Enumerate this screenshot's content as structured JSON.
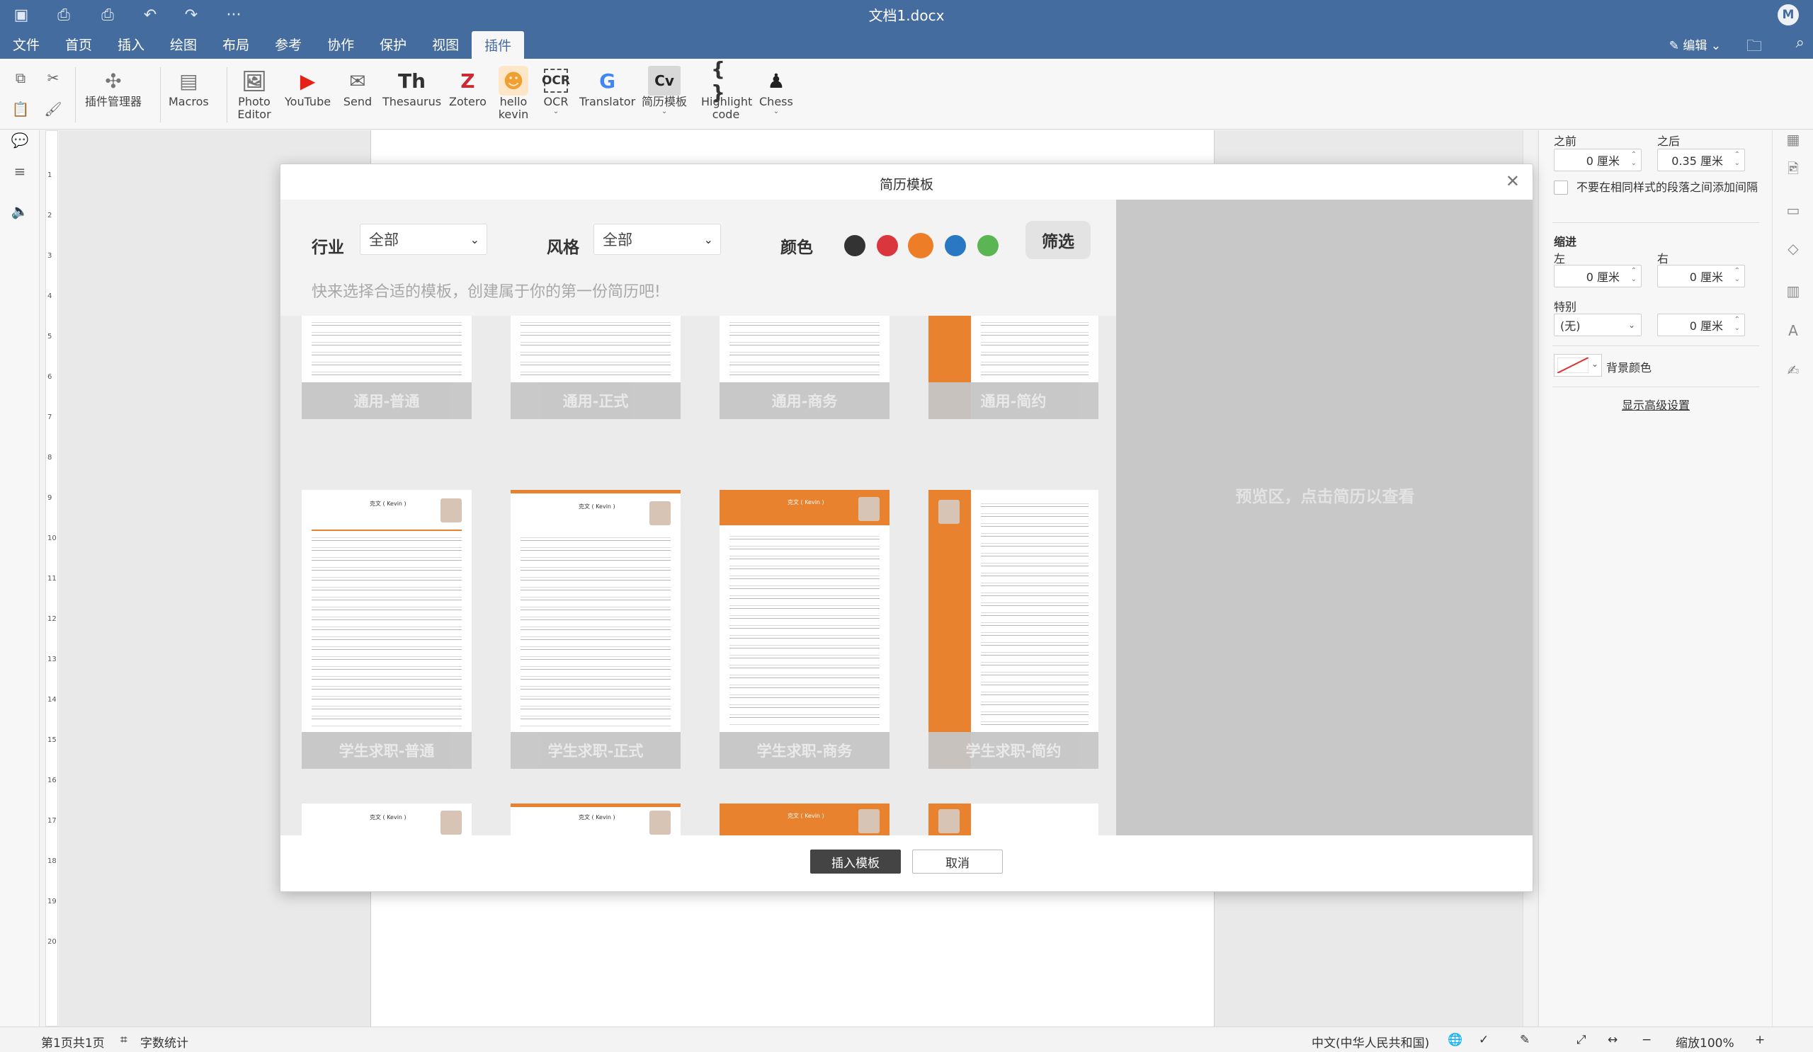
{
  "window": {
    "title": "文档1.docx",
    "avatar": "M"
  },
  "menu": [
    {
      "label": "文件"
    },
    {
      "label": "首页"
    },
    {
      "label": "插入"
    },
    {
      "label": "绘图"
    },
    {
      "label": "布局"
    },
    {
      "label": "参考"
    },
    {
      "label": "协作"
    },
    {
      "label": "保护"
    },
    {
      "label": "视图"
    },
    {
      "label": "插件",
      "active": true
    }
  ],
  "edit_mode": "编辑",
  "ribbon": {
    "plugin_manager": "插件管理器",
    "macros": "Macros",
    "photo_editor": "Photo Editor",
    "youtube": "YouTube",
    "send": "Send",
    "thesaurus": "Thesaurus",
    "zotero": "Zotero",
    "hello_kevin": "hello kevin",
    "ocr": "OCR",
    "translator": "Translator",
    "resume": "简历模板",
    "highlight": "Highlight code",
    "chess": "Chess",
    "icon_glyphs": {
      "thesaurus": "Th",
      "zotero": "Z",
      "ocr": "OCR",
      "resume": "Cv",
      "highlight": "{ }"
    }
  },
  "right_panel": {
    "before_label": "之前",
    "after_label": "之后",
    "before_value": "0 厘米",
    "after_value": "0.35 厘米",
    "no_space_same_style": "不要在相同样式的段落之间添加间隔",
    "indent_label": "缩进",
    "left_label": "左",
    "right_label": "右",
    "indent_left": "0 厘米",
    "indent_right": "0 厘米",
    "special_label": "特别",
    "special_value": "(无)",
    "special_amount": "0 厘米",
    "bg_color_label": "背景颜色",
    "advanced_link": "显示高级设置"
  },
  "dialog": {
    "title": "简历模板",
    "industry_label": "行业",
    "industry_value": "全部",
    "style_label": "风格",
    "style_value": "全部",
    "color_label": "颜色",
    "colors": [
      "#333333",
      "#d9363e",
      "#ee7d28",
      "#2a78c4",
      "#5ab552"
    ],
    "filter_button": "筛选",
    "hint": "快来选择合适的模板，创建属于你的第一份简历吧!",
    "templates_row1": [
      "通用-普通",
      "通用-正式",
      "通用-商务",
      "通用-简约"
    ],
    "templates_row2": [
      "学生求职-普通",
      "学生求职-正式",
      "学生求职-商务",
      "学生求职-简约"
    ],
    "preview_hint": "预览区，点击简历以查看",
    "insert_button": "插入模板",
    "cancel_button": "取消",
    "resume_name": "克文 ( Kevin )"
  },
  "statusbar": {
    "page": "第1页共1页",
    "word_count": "字数统计",
    "language": "中文(中华人民共和国)",
    "zoom": "缩放100%"
  },
  "accent_color": "#456c9e",
  "template_orange": "#e8822e"
}
